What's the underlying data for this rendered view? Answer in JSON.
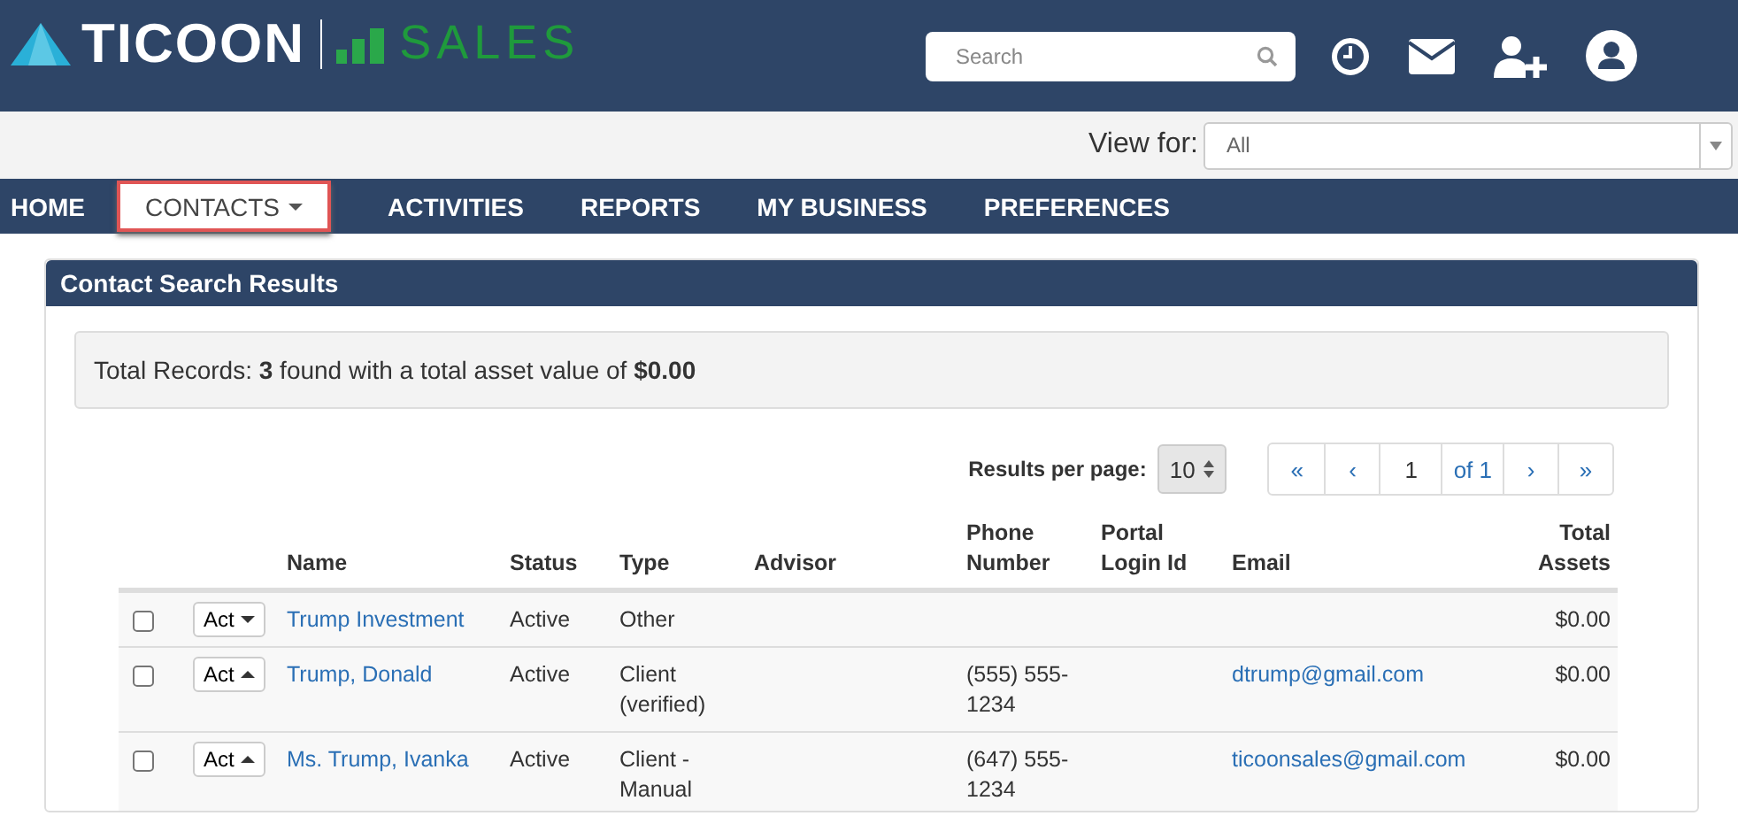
{
  "header": {
    "brand": "TICOON",
    "product": "SALES",
    "search": {
      "placeholder": "Search"
    }
  },
  "view_for": {
    "label": "View for:",
    "value": "All"
  },
  "nav": [
    {
      "label": "HOME",
      "selected": false,
      "dropdown": false
    },
    {
      "label": "CONTACTS",
      "selected": true,
      "dropdown": true
    },
    {
      "label": "ACTIVITIES",
      "selected": false,
      "dropdown": false
    },
    {
      "label": "REPORTS",
      "selected": false,
      "dropdown": false
    },
    {
      "label": "MY BUSINESS",
      "selected": false,
      "dropdown": false
    },
    {
      "label": "PREFERENCES",
      "selected": false,
      "dropdown": false
    }
  ],
  "panel": {
    "title": "Contact Search Results",
    "summary": "Total Records: **3** found with a total asset value of **$0.00**",
    "per_page": {
      "label": "Results per page:",
      "value": "10"
    },
    "pagination": {
      "first": "«",
      "prev": "‹",
      "page": "1",
      "of": "of 1",
      "next": "›",
      "last": "»"
    }
  },
  "table": {
    "columns": [
      "Name",
      "Status",
      "Type",
      "Advisor",
      "Phone Number",
      "Portal Login Id",
      "Email",
      "Total Assets"
    ],
    "rows": [
      {
        "checked": false,
        "action": "Act",
        "menu_open": false,
        "name": "Trump Investment",
        "status": "Active",
        "type": "Other",
        "assets": "$0.00"
      },
      {
        "checked": false,
        "action": "Act",
        "menu_open": true,
        "name": "Trump, Donald",
        "status": "Active",
        "type": "Client (verified)",
        "phone": "(555) 555-1234",
        "email": "dtrump@gmail.com",
        "assets": "$0.00"
      },
      {
        "checked": false,
        "action": "Act",
        "menu_open": true,
        "name": "Ms. Trump, Ivanka",
        "status": "Active",
        "type": "Client - Manual",
        "phone": "(647) 555-1234",
        "email": "ticoonsales@gmail.com",
        "assets": "$0.00"
      }
    ]
  }
}
